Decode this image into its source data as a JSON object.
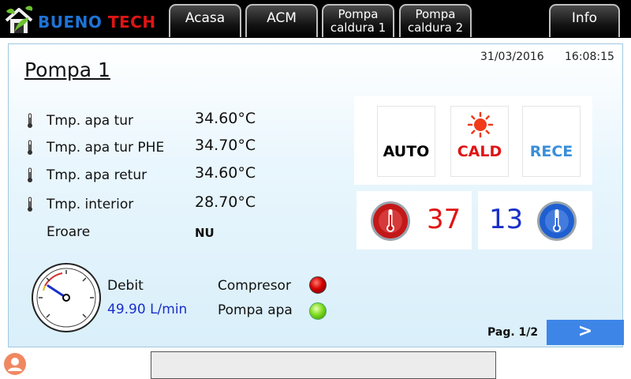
{
  "header": {
    "brand": {
      "word1": "BUENO",
      "word2": "TECH"
    },
    "tabs": [
      {
        "line1": "Acasa"
      },
      {
        "line1": "ACM"
      },
      {
        "line1": "Pompa",
        "line2": "caldura 1"
      },
      {
        "line1": "Pompa",
        "line2": "caldura 2"
      },
      {
        "line1": "Info"
      }
    ]
  },
  "page": {
    "title": "Pompa 1",
    "date": "31/03/2016",
    "time": "16:08:15"
  },
  "readings": [
    {
      "label": "Tmp. apa tur",
      "value": "34.60°C"
    },
    {
      "label": "Tmp. apa tur PHE",
      "value": "34.70°C"
    },
    {
      "label": "Tmp. apa retur",
      "value": "34.60°C"
    },
    {
      "label": "Tmp. interior",
      "value": "28.70°C"
    },
    {
      "label": "Eroare",
      "value": "NU"
    }
  ],
  "modes": {
    "auto": "AUTO",
    "heat": "CALD",
    "cool": "RECE"
  },
  "setpoints": {
    "heat": "37",
    "cool": "13"
  },
  "flow": {
    "label": "Debit",
    "value": "49.90 L/min"
  },
  "status": {
    "compressor_label": "Compresor",
    "pump_label": "Pompa apa"
  },
  "pagination": {
    "label": "Pag. 1/2",
    "next": ">"
  },
  "colors": {
    "accent_blue": "#3d86e8",
    "brand_blue": "#1e73d6",
    "brand_red": "#e01414",
    "heat_red": "#e01414",
    "cool_blue": "#3a8fd8",
    "value_blue": "#1a2fc8",
    "led_compressor": "#d40000",
    "led_pump": "#7fdc1f"
  }
}
